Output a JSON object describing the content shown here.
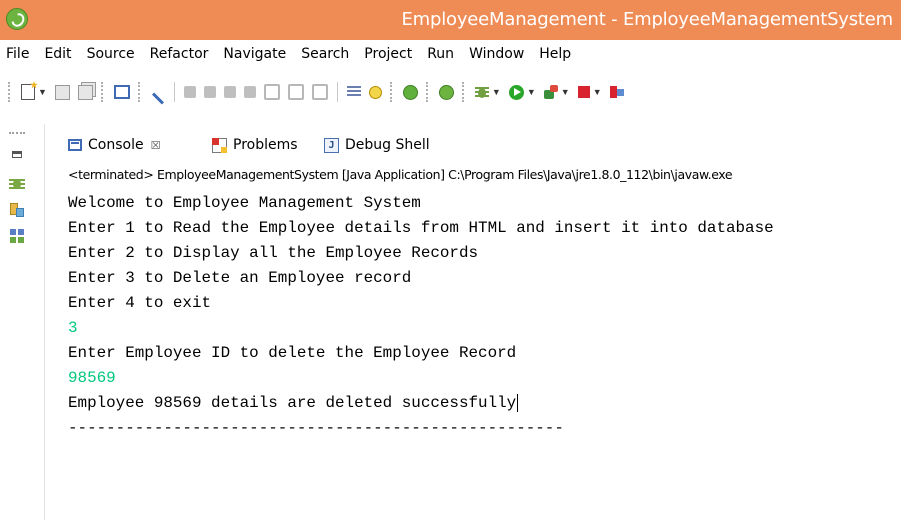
{
  "window": {
    "title": "EmployeeManagement - EmployeeManagementSystem",
    "logo_icon": "spring-tool-suite-icon"
  },
  "menu": [
    "File",
    "Edit",
    "Source",
    "Refactor",
    "Navigate",
    "Search",
    "Project",
    "Run",
    "Window",
    "Help"
  ],
  "toolbar": {
    "icons": [
      "new-icon",
      "save-icon",
      "save-all-icon",
      "console-icon",
      "pen-icon",
      "resume-icon",
      "suspend-icon",
      "terminate-icon",
      "disconnect-icon",
      "step-into-icon",
      "step-over-icon",
      "step-return-icon",
      "use-step-filters-icon",
      "debug-ant-icon",
      "spring-boot-icon",
      "spring-icon",
      "debug-icon",
      "run-icon",
      "external-tools-icon",
      "stop-icon",
      "run-last-icon"
    ]
  },
  "trim": {
    "icons": [
      "maximize-icon",
      "debug-view-icon",
      "package-explorer-icon",
      "type-hierarchy-icon"
    ]
  },
  "tabs": [
    {
      "label": "Console",
      "icon": "console-icon",
      "close": "☒"
    },
    {
      "label": "Problems",
      "icon": "problems-icon"
    },
    {
      "label": "Debug Shell",
      "icon": "debug-shell-icon",
      "icon_letter": "J"
    }
  ],
  "console": {
    "header": "<terminated> EmployeeManagementSystem [Java Application] C:\\Program Files\\Java\\jre1.8.0_112\\bin\\javaw.exe",
    "lines": [
      {
        "text": "Welcome to Employee Management System",
        "type": "output"
      },
      {
        "text": "Enter 1 to Read the Employee details from HTML and insert it into database",
        "type": "output"
      },
      {
        "text": "Enter 2 to Display all the Employee Records",
        "type": "output"
      },
      {
        "text": "Enter 3 to Delete an Employee record",
        "type": "output"
      },
      {
        "text": "Enter 4 to exit",
        "type": "output"
      },
      {
        "text": "3",
        "type": "input"
      },
      {
        "text": "Enter Employee ID to delete the Employee Record",
        "type": "output"
      },
      {
        "text": "98569",
        "type": "input"
      },
      {
        "text": "Employee 98569 details are deleted successfully",
        "type": "output"
      },
      {
        "text": "----------------------------------------------------",
        "type": "output"
      }
    ]
  },
  "colors": {
    "titlebar": "#ef8c55",
    "input_text": "#00c87d",
    "output_text": "#000000"
  }
}
